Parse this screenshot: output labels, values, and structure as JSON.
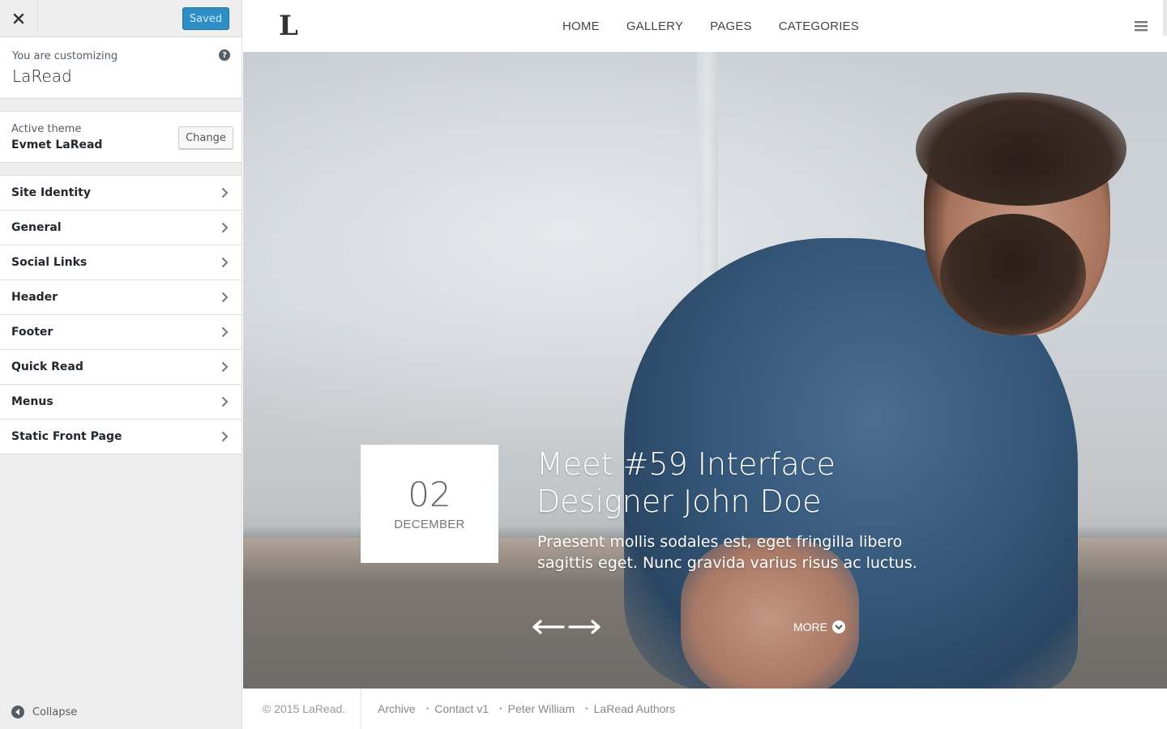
{
  "customizer": {
    "saved_label": "Saved",
    "customizing_label": "You are customizing",
    "site_name": "LaRead",
    "active_theme_label": "Active theme",
    "active_theme_name": "Evmet LaRead",
    "change_label": "Change",
    "sections": [
      {
        "label": "Site Identity"
      },
      {
        "label": "General"
      },
      {
        "label": "Social Links"
      },
      {
        "label": "Header"
      },
      {
        "label": "Footer"
      },
      {
        "label": "Quick Read"
      },
      {
        "label": "Menus"
      },
      {
        "label": "Static Front Page"
      }
    ],
    "collapse_label": "Collapse",
    "icons": {
      "close": "close-icon",
      "help": "help-icon",
      "chevron": "chevron-right-icon",
      "collapse": "collapse-arrow-icon"
    },
    "accent_color": "#2e8fc7"
  },
  "preview": {
    "logo": "L",
    "nav": [
      "HOME",
      "GALLERY",
      "PAGES",
      "CATEGORIES"
    ],
    "hero": {
      "date_day": "02",
      "date_month": "DECEMBER",
      "title": "Meet #59 Interface Designer John Doe",
      "excerpt": "Praesent mollis sodales est, eget fringilla libero sagittis eget. Nunc gravida varius risus ac luctus.",
      "more_label": "MORE"
    },
    "footer": {
      "copyright": "© 2015 LaRead.",
      "links": [
        "Archive",
        "Contact v1",
        "Peter William",
        "LaRead Authors"
      ]
    }
  }
}
